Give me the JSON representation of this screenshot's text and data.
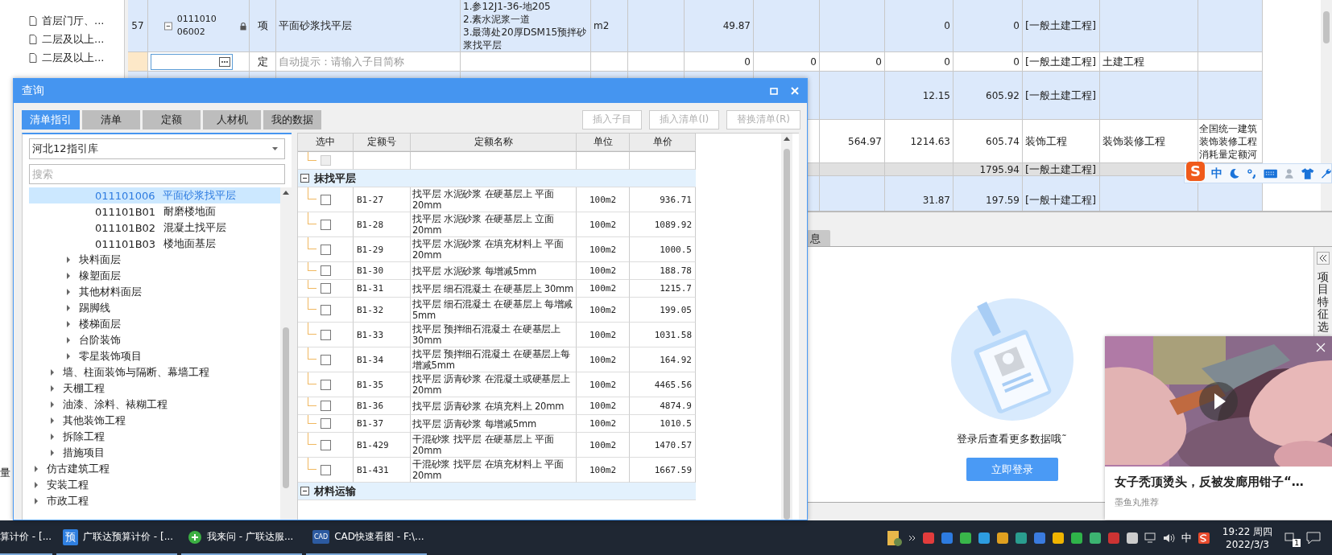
{
  "left_tree": {
    "items": [
      {
        "label": "首层门厅、..."
      },
      {
        "label": "二层及以上..."
      },
      {
        "label": "二层及以上..."
      }
    ],
    "footer": "量"
  },
  "main_table": {
    "rows": [
      {
        "kind": "item",
        "expanded": true,
        "locked": true,
        "cells": [
          "57",
          "011101006002",
          "项",
          "平面砂浆找平层",
          "1.参12J1-36-地205\n2.素水泥浆一道\n3.最薄处20厚DSM15预拌砂浆找平层",
          "m2",
          "",
          "49.87",
          "",
          "",
          "0",
          "0",
          "[一般土建工程]",
          "",
          ""
        ]
      },
      {
        "kind": "input",
        "placeholder": "自动提示：请输入子目简称",
        "cells": [
          "",
          "",
          "定",
          "",
          "",
          "",
          "",
          "0",
          "0",
          "0",
          "0",
          "0",
          "[一般土建工程]",
          "土建工程",
          ""
        ]
      },
      {
        "kind": "item",
        "cells": [
          "",
          "",
          "",
          "",
          "",
          "",
          "",
          "",
          "",
          "",
          "12.15",
          "605.92",
          "[一般土建工程]",
          "",
          ""
        ]
      },
      {
        "kind": "detail",
        "cells": [
          "",
          "",
          "",
          "",
          "",
          "",
          "",
          "",
          "",
          "564.97",
          "1214.63",
          "605.74",
          "装饰工程",
          "装饰装修工程",
          "全国统一建筑装饰装修工程消耗量定额河"
        ]
      },
      {
        "kind": "subtotal",
        "cells": [
          "",
          "",
          "",
          "",
          "",
          "",
          "",
          "",
          "",
          "",
          "",
          "1795.94",
          "[一般土建工程]",
          "",
          ""
        ]
      },
      {
        "kind": "item",
        "cells": [
          "",
          "",
          "",
          "",
          "",
          "",
          "",
          "",
          "",
          "",
          "31.87",
          "197.59",
          "[一般十建工程]",
          "",
          ""
        ]
      }
    ]
  },
  "bottom_panel": {
    "tab": "息",
    "message": "登录后查看更多数据哦˜",
    "login_button": "立即登录",
    "side_label": "项目特征选"
  },
  "dialog": {
    "title": "查询",
    "tabs": [
      {
        "label": "清单指引",
        "selected": true
      },
      {
        "label": "清单",
        "selected": false
      },
      {
        "label": "定额",
        "selected": false
      },
      {
        "label": "人材机",
        "selected": false
      },
      {
        "label": "我的数据",
        "selected": false
      }
    ],
    "actions": [
      {
        "label": "插入子目",
        "disabled": true
      },
      {
        "label": "插入清单(I)",
        "disabled": true
      },
      {
        "label": "替换清单(R)",
        "disabled": true
      }
    ],
    "library": "河北12指引库",
    "search": {
      "placeholder": "搜索"
    },
    "tree": [
      {
        "children": [
          {
            "children": [
              {
                "children": [
                  {
                    "code": "011101006",
                    "label": "平面砂浆找平层",
                    "selected": true
                  },
                  {
                    "code": "011101B01",
                    "label": "耐磨楼地面",
                    "selected": false
                  },
                  {
                    "code": "011101B02",
                    "label": "混凝土找平层",
                    "selected": false
                  },
                  {
                    "code": "011101B03",
                    "label": "楼地面基层",
                    "selected": false
                  }
                ]
              },
              {
                "label": "块料面层",
                "expanded": false
              },
              {
                "label": "橡塑面层",
                "expanded": false
              },
              {
                "label": "其他材料面层",
                "expanded": false
              },
              {
                "label": "踢脚线",
                "expanded": false
              },
              {
                "label": "楼梯面层",
                "expanded": false
              },
              {
                "label": "台阶装饰",
                "expanded": false
              },
              {
                "label": "零星装饰项目",
                "expanded": false
              }
            ]
          },
          {
            "label": "墙、柱面装饰与隔断、幕墙工程",
            "expanded": false
          },
          {
            "label": "天棚工程",
            "expanded": false
          },
          {
            "label": "油漆、涂料、裱糊工程",
            "expanded": false
          },
          {
            "label": "其他装饰工程",
            "expanded": false
          },
          {
            "label": "拆除工程",
            "expanded": false
          },
          {
            "label": "措施项目",
            "expanded": false
          }
        ]
      },
      {
        "label": "仿古建筑工程",
        "expanded": false
      },
      {
        "label": "安装工程",
        "expanded": false
      },
      {
        "label": "市政工程",
        "expanded": false
      }
    ],
    "grid": {
      "columns": [
        "选中",
        "定额号",
        "定额名称",
        "单位",
        "单价"
      ],
      "rows": [
        {
          "kind": "blank",
          "checked": false,
          "disabled": true
        },
        {
          "kind": "group",
          "label": "抹找平层",
          "expanded": true
        },
        {
          "kind": "item",
          "code": "B1-27",
          "name": "找平层 水泥砂浆 在硬基层上 平面 20mm",
          "unit": "100m2",
          "price": "936.71",
          "checked": false
        },
        {
          "kind": "item",
          "code": "B1-28",
          "name": "找平层 水泥砂浆 在硬基层上 立面 20mm",
          "unit": "100m2",
          "price": "1089.92",
          "checked": false
        },
        {
          "kind": "item",
          "code": "B1-29",
          "name": "找平层 水泥砂浆 在填充材料上 平面 20mm",
          "unit": "100m2",
          "price": "1000.5",
          "checked": false
        },
        {
          "kind": "item",
          "code": "B1-30",
          "name": "找平层 水泥砂浆 每增减5mm",
          "unit": "100m2",
          "price": "188.78",
          "checked": false
        },
        {
          "kind": "item",
          "code": "B1-31",
          "name": "找平层 细石混凝土 在硬基层上 30mm",
          "unit": "100m2",
          "price": "1215.7",
          "checked": false
        },
        {
          "kind": "item",
          "code": "B1-32",
          "name": "找平层 细石混凝土 在硬基层上 每增减5mm",
          "unit": "100m2",
          "price": "199.05",
          "checked": false
        },
        {
          "kind": "item",
          "code": "B1-33",
          "name": "找平层 预拌细石混凝土 在硬基层上 30mm",
          "unit": "100m2",
          "price": "1031.58",
          "checked": false
        },
        {
          "kind": "item",
          "code": "B1-34",
          "name": "找平层 预拌细石混凝土 在硬基层上每增减5mm",
          "unit": "100m2",
          "price": "164.92",
          "checked": false
        },
        {
          "kind": "item",
          "code": "B1-35",
          "name": "找平层 沥青砂浆 在混凝土或硬基层上 20mm",
          "unit": "100m2",
          "price": "4465.56",
          "checked": false
        },
        {
          "kind": "item",
          "code": "B1-36",
          "name": "找平层 沥青砂浆 在填充料上 20mm",
          "unit": "100m2",
          "price": "4874.9",
          "checked": false
        },
        {
          "kind": "item",
          "code": "B1-37",
          "name": "找平层 沥青砂浆 每增减5mm",
          "unit": "100m2",
          "price": "1010.5",
          "checked": false
        },
        {
          "kind": "item",
          "code": "B1-429",
          "name": "干混砂浆 找平层 在硬基层上 平面 20mm",
          "unit": "100m2",
          "price": "1470.57",
          "checked": false
        },
        {
          "kind": "item",
          "code": "B1-431",
          "name": "干混砂浆 找平层 在填充材料上 平面 20mm",
          "unit": "100m2",
          "price": "1667.59",
          "checked": false
        },
        {
          "kind": "group",
          "label": "材料运输",
          "expanded": true
        }
      ]
    }
  },
  "ime_bar": {
    "logo": "S",
    "mode": "中"
  },
  "ad": {
    "title": "女子秃顶烫头，反被发廊用钳子“…",
    "source": "墨鱼丸推荐"
  },
  "taskbar": {
    "apps": [
      {
        "label": "算计价 - [..."
      },
      {
        "label": "广联达预算计价 - [...",
        "icon_text": "预"
      },
      {
        "label": "我来问 - 广联达服..."
      },
      {
        "label": "CAD快速看图 - F:\\...",
        "icon_text": "CAD"
      }
    ],
    "ime": "中",
    "time": "19:22 周四",
    "date": "2022/3/3",
    "notifications": "1"
  }
}
